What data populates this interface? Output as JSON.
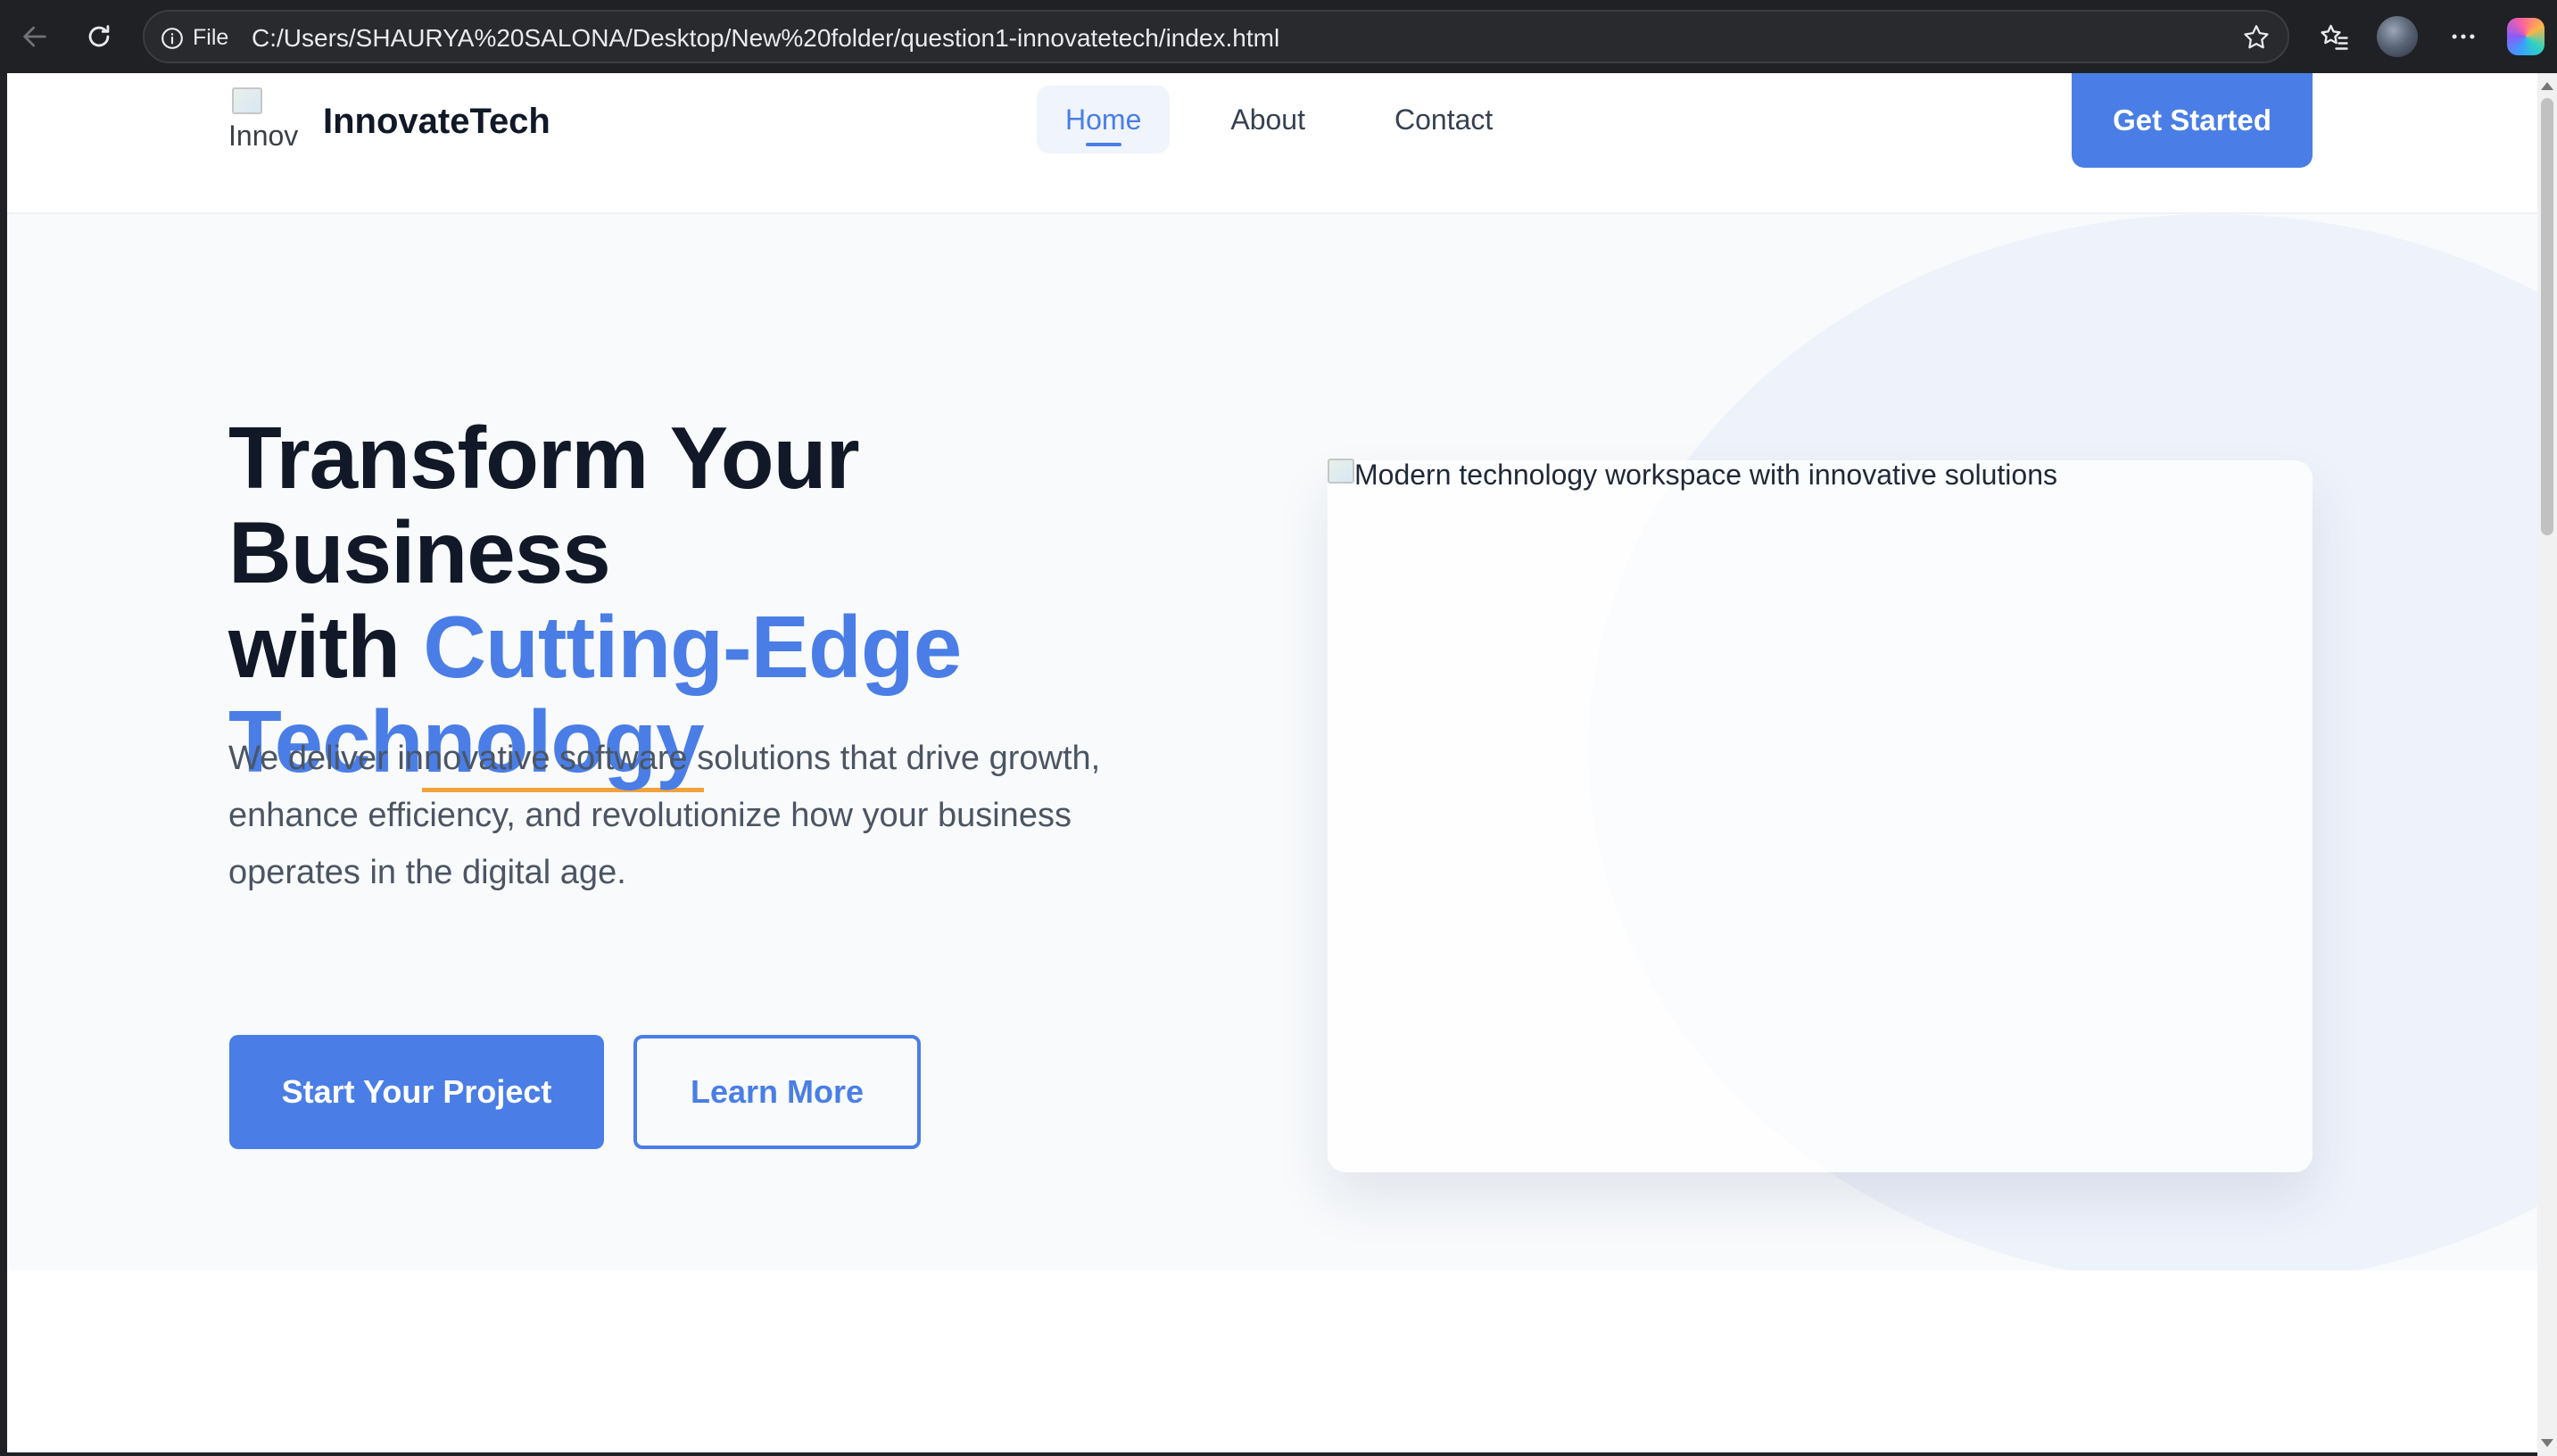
{
  "browser": {
    "file_label": "File",
    "url": "C:/Users/SHAURYA%20SALONA/Desktop/New%20folder/question1-innovatetech/index.html"
  },
  "header": {
    "logo_alt": "Innov",
    "brand": "InnovateTech",
    "nav": [
      {
        "label": "Home",
        "active": true
      },
      {
        "label": "About",
        "active": false
      },
      {
        "label": "Contact",
        "active": false
      }
    ],
    "cta": "Get Started"
  },
  "hero": {
    "title_line1": "Transform Your Business",
    "title_with": "with ",
    "title_accent": "Cutting-Edge",
    "title_tech_pre": "Tech",
    "title_tech_under": "nology",
    "description": "We deliver innovative software solutions that drive growth, enhance efficiency, and revolutionize how your business operates in the digital age.",
    "primary_button": "Start Your Project",
    "secondary_button": "Learn More",
    "image_alt": "Modern technology workspace with innovative solutions"
  },
  "colors": {
    "accent": "#4a7ee6",
    "underline": "#f0a23c",
    "heading": "#111827",
    "body_text": "#4b5563"
  }
}
